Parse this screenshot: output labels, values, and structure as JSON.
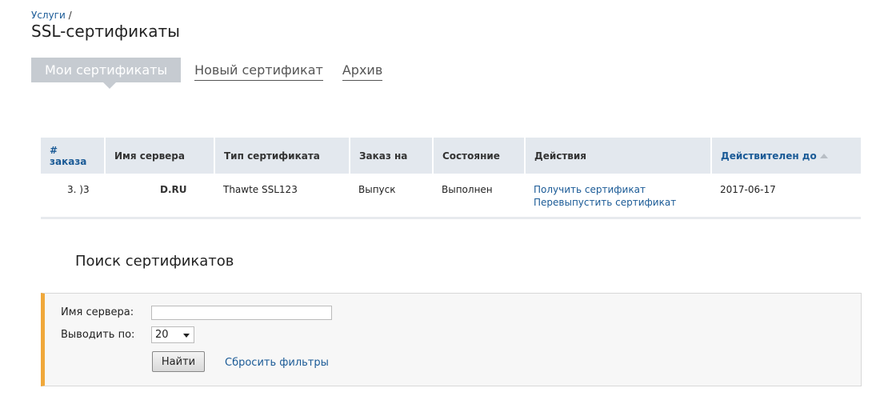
{
  "breadcrumb": {
    "parent": "Услуги",
    "separator": " /"
  },
  "page_title": "SSL-сертификаты",
  "tabs": [
    {
      "label": "Мои сертификаты",
      "active": true
    },
    {
      "label": "Новый сертификат",
      "active": false
    },
    {
      "label": "Архив",
      "active": false
    }
  ],
  "table": {
    "headers": {
      "order": "# заказа",
      "server": "Имя сервера",
      "type": "Тип сертификата",
      "order_for": "Заказ на",
      "status": "Состояние",
      "actions": "Действия",
      "valid_until": "Действителен до"
    },
    "rows": [
      {
        "order": "3.  )3",
        "server": "D.RU",
        "type": "Thawte SSL123",
        "order_for": "Выпуск",
        "status": "Выполнен",
        "action_get": "Получить сертификат",
        "action_reissue": "Перевыпустить сертификат",
        "valid_until": "2017-06-17"
      }
    ]
  },
  "search": {
    "title": "Поиск сертификатов",
    "server_label": "Имя сервера:",
    "server_value": "",
    "per_page_label": "Выводить по:",
    "per_page_value": "20",
    "find_label": "Найти",
    "reset_label": "Сбросить фильтры"
  },
  "colors": {
    "link": "#1a5a96",
    "accent": "#f0a83a",
    "tab_active": "#c6cbd1",
    "header_bg": "#e3e8ee"
  }
}
